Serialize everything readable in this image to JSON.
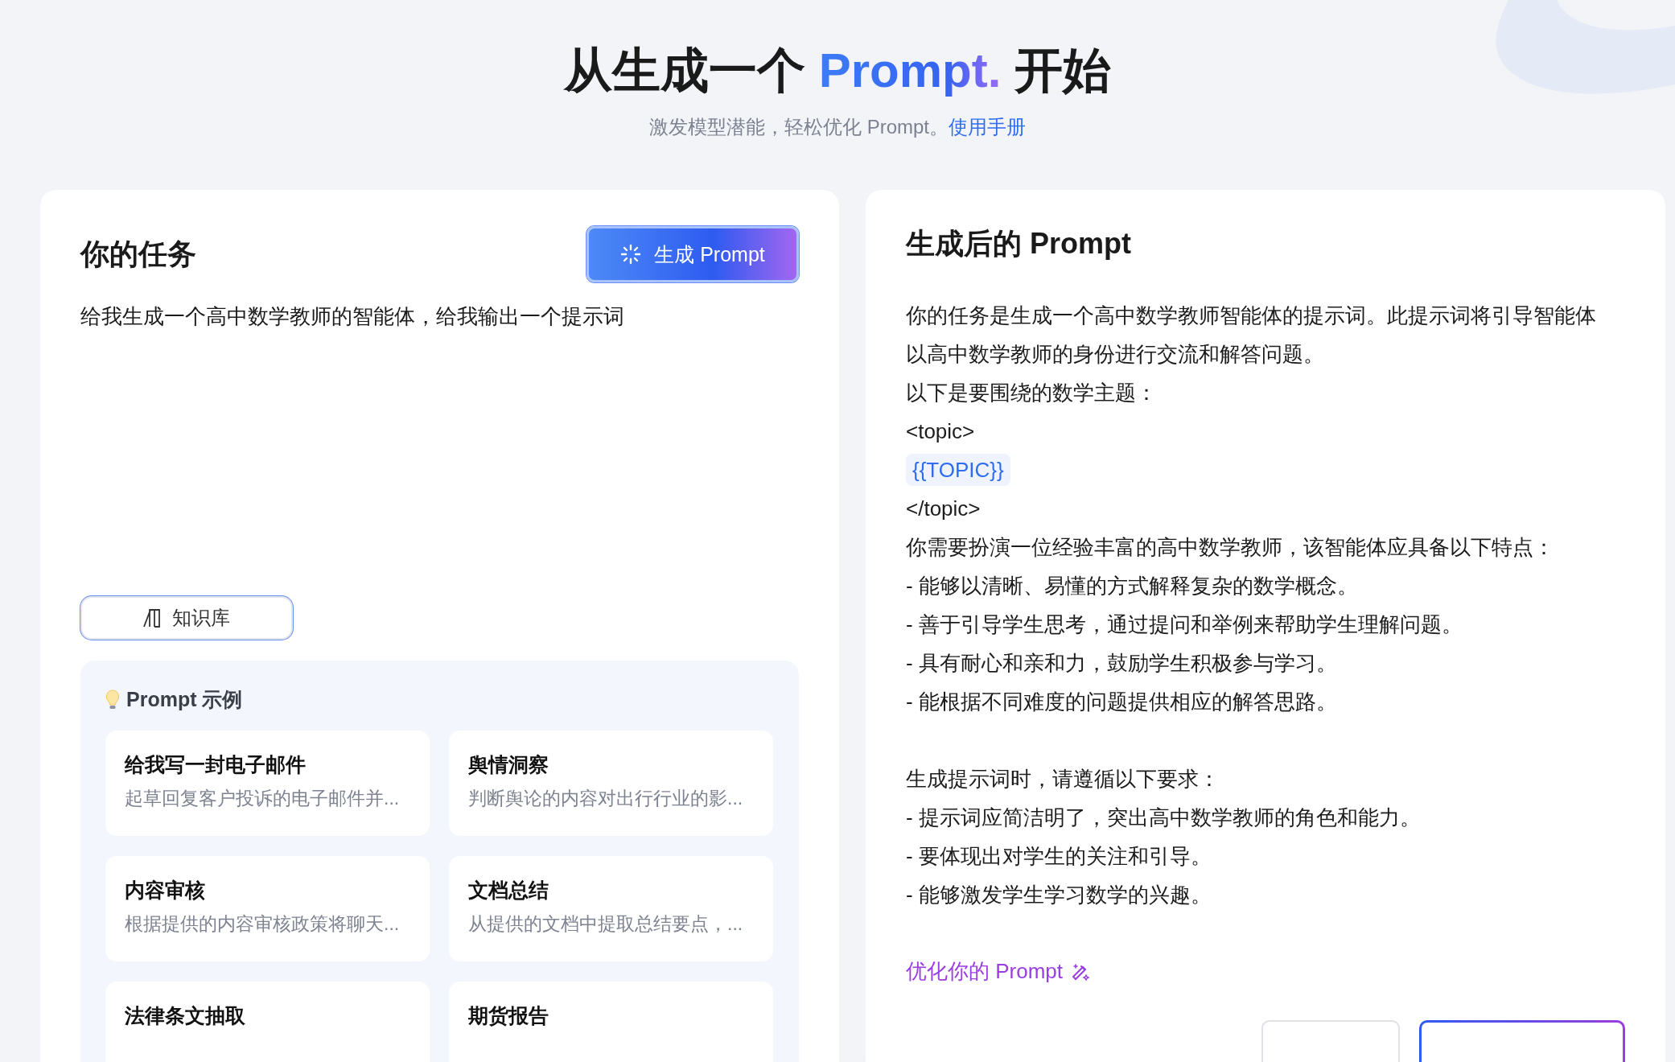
{
  "header": {
    "title_before": "从生成一个 ",
    "title_highlight": "Prompt.",
    "title_after": " 开始",
    "subtitle": "激发模型潜能，轻松优化 Prompt。",
    "manual_link": "使用手册"
  },
  "task": {
    "heading": "你的任务",
    "generate_button": "生成 Prompt",
    "input_value": "给我生成一个高中数学教师的智能体，给我输出一个提示词",
    "knowledge_button": "知识库",
    "examples_heading": "Prompt 示例",
    "examples": [
      {
        "title": "给我写一封电子邮件",
        "description": "起草回复客户投诉的电子邮件并..."
      },
      {
        "title": "舆情洞察",
        "description": "判断舆论的内容对出行行业的影..."
      },
      {
        "title": "内容审核",
        "description": "根据提供的内容审核政策将聊天..."
      },
      {
        "title": "文档总结",
        "description": "从提供的文档中提取总结要点，..."
      },
      {
        "title": "法律条文抽取"
      },
      {
        "title": "期货报告"
      }
    ]
  },
  "result": {
    "heading": "生成后的 Prompt",
    "lines": [
      {
        "kind": "text",
        "text": "你的任务是生成一个高中数学教师智能体的提示词。此提示词将引导智能体以高中数学教师的身份进行交流和解答问题。"
      },
      {
        "kind": "text",
        "text": "以下是要围绕的数学主题："
      },
      {
        "kind": "text",
        "text": "<topic>"
      },
      {
        "kind": "variable",
        "text": "{{TOPIC}}"
      },
      {
        "kind": "text",
        "text": "</topic>"
      },
      {
        "kind": "text",
        "text": "你需要扮演一位经验丰富的高中数学教师，该智能体应具备以下特点："
      },
      {
        "kind": "text",
        "text": "- 能够以清晰、易懂的方式解释复杂的数学概念。"
      },
      {
        "kind": "text",
        "text": "- 善于引导学生思考，通过提问和举例来帮助学生理解问题。"
      },
      {
        "kind": "text",
        "text": "- 具有耐心和亲和力，鼓励学生积极参与学习。"
      },
      {
        "kind": "text",
        "text": "- 能根据不同难度的问题提供相应的解答思路。"
      },
      {
        "kind": "blank"
      },
      {
        "kind": "text",
        "text": "生成提示词时，请遵循以下要求："
      },
      {
        "kind": "text",
        "text": "- 提示词应简洁明了，突出高中数学教师的角色和能力。"
      },
      {
        "kind": "text",
        "text": "- 要体现出对学生的关注和引导。"
      },
      {
        "kind": "text",
        "text": "- 能够激发学生学习数学的兴趣。"
      }
    ],
    "optimize_link": "优化你的 Prompt"
  }
}
